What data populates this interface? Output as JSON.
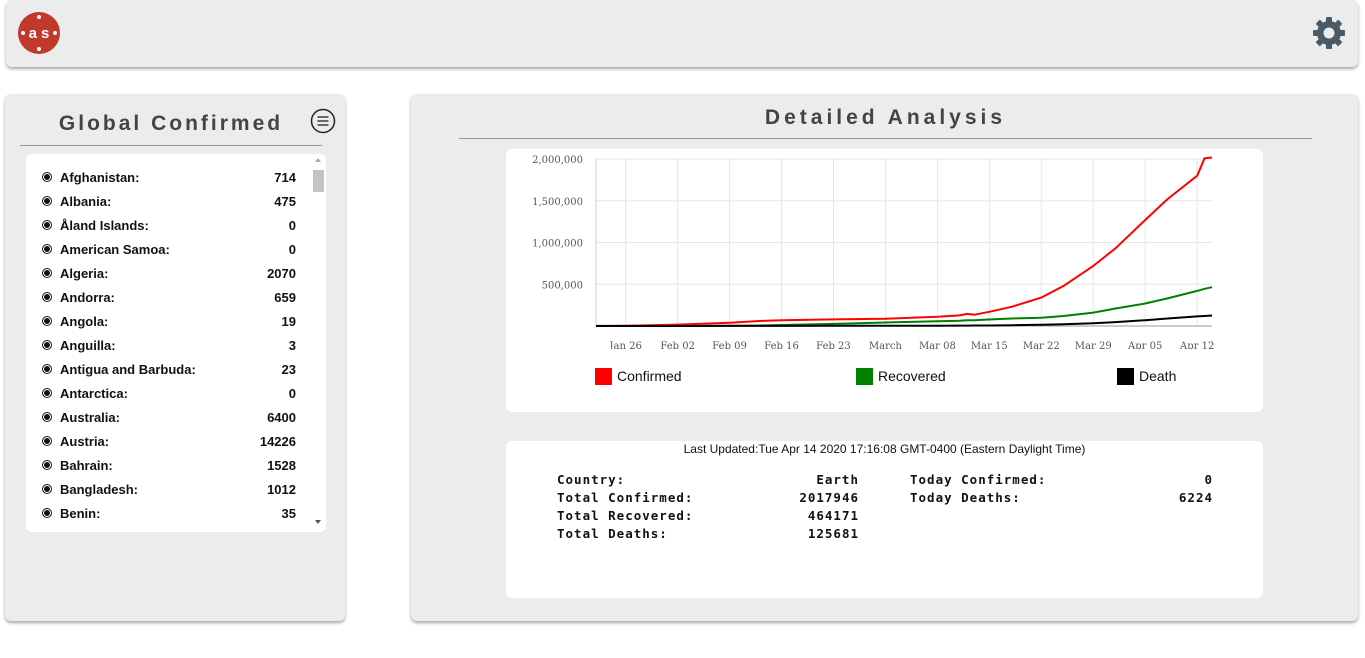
{
  "header": {
    "logo_text": "as",
    "settings_icon": "gear-icon"
  },
  "left_panel": {
    "title": "Global Confirmed",
    "menu_icon": "menu-lines-icon",
    "countries": [
      {
        "name": "Afghanistan:",
        "count": "714"
      },
      {
        "name": "Albania:",
        "count": "475"
      },
      {
        "name": "Åland Islands:",
        "count": "0"
      },
      {
        "name": "American Samoa:",
        "count": "0"
      },
      {
        "name": "Algeria:",
        "count": "2070"
      },
      {
        "name": "Andorra:",
        "count": "659"
      },
      {
        "name": "Angola:",
        "count": "19"
      },
      {
        "name": "Anguilla:",
        "count": "3"
      },
      {
        "name": "Antigua and Barbuda:",
        "count": "23"
      },
      {
        "name": "Antarctica:",
        "count": "0"
      },
      {
        "name": "Australia:",
        "count": "6400"
      },
      {
        "name": "Austria:",
        "count": "14226"
      },
      {
        "name": "Bahrain:",
        "count": "1528"
      },
      {
        "name": "Bangladesh:",
        "count": "1012"
      },
      {
        "name": "Benin:",
        "count": "35"
      }
    ]
  },
  "right_panel": {
    "title": "Detailed Analysis",
    "last_updated": "Last Updated:Tue Apr 14 2020 17:16:08 GMT-0400 (Eastern Daylight Time)",
    "stats": {
      "country_label": "Country:",
      "country_value": "Earth",
      "total_confirmed_label": "Total Confirmed:",
      "total_confirmed_value": "2017946",
      "total_recovered_label": "Total Recovered:",
      "total_recovered_value": "464171",
      "total_deaths_label": "Total Deaths:",
      "total_deaths_value": "125681",
      "today_confirmed_label": "Today Confirmed:",
      "today_confirmed_value": "0",
      "today_deaths_label": "Today Deaths:",
      "today_deaths_value": "6224"
    }
  },
  "chart_data": {
    "type": "line",
    "title": "",
    "xlabel": "",
    "ylabel": "",
    "x_tick_labels": [
      "Jan 26",
      "Feb 02",
      "Feb 09",
      "Feb 16",
      "Feb 23",
      "March",
      "Mar 08",
      "Mar 15",
      "Mar 22",
      "Mar 29",
      "Apr 05",
      "Apr 12"
    ],
    "y_tick_labels": [
      "500,000",
      "1,000,000",
      "1,500,000",
      "2,000,000"
    ],
    "y_ticks": [
      500000,
      1000000,
      1500000,
      2000000
    ],
    "ylim": [
      0,
      2000000
    ],
    "x": [
      "Jan 22",
      "Jan 26",
      "Feb 02",
      "Feb 09",
      "Feb 13",
      "Feb 16",
      "Feb 23",
      "Mar 01",
      "Mar 08",
      "Mar 11",
      "Mar 12",
      "Mar 13",
      "Mar 15",
      "Mar 18",
      "Mar 22",
      "Mar 25",
      "Mar 29",
      "Apr 01",
      "Apr 05",
      "Apr 08",
      "Apr 12",
      "Apr 13",
      "Apr 14"
    ],
    "grid": true,
    "legend_position": "bottom",
    "series": [
      {
        "name": "Confirmed",
        "color": "#ff0000",
        "values": [
          600,
          2100,
          17000,
          40000,
          60000,
          69000,
          79000,
          88000,
          110000,
          127000,
          145000,
          135000,
          170000,
          230000,
          340000,
          480000,
          720000,
          930000,
          1270000,
          1520000,
          1800000,
          2010000,
          2017946
        ]
      },
      {
        "name": "Recovered",
        "color": "#008000",
        "values": [
          30,
          50,
          500,
          3000,
          6000,
          12000,
          25000,
          42000,
          58000,
          64000,
          68000,
          70000,
          78000,
          90000,
          100000,
          120000,
          160000,
          210000,
          270000,
          330000,
          420000,
          445000,
          464171
        ]
      },
      {
        "name": "Death",
        "color": "#000000",
        "values": [
          17,
          56,
          360,
          900,
          1400,
          1700,
          2500,
          3000,
          3600,
          4300,
          4600,
          5400,
          6500,
          9000,
          15000,
          22000,
          34000,
          47000,
          69000,
          90000,
          115000,
          120000,
          125681
        ]
      }
    ]
  }
}
